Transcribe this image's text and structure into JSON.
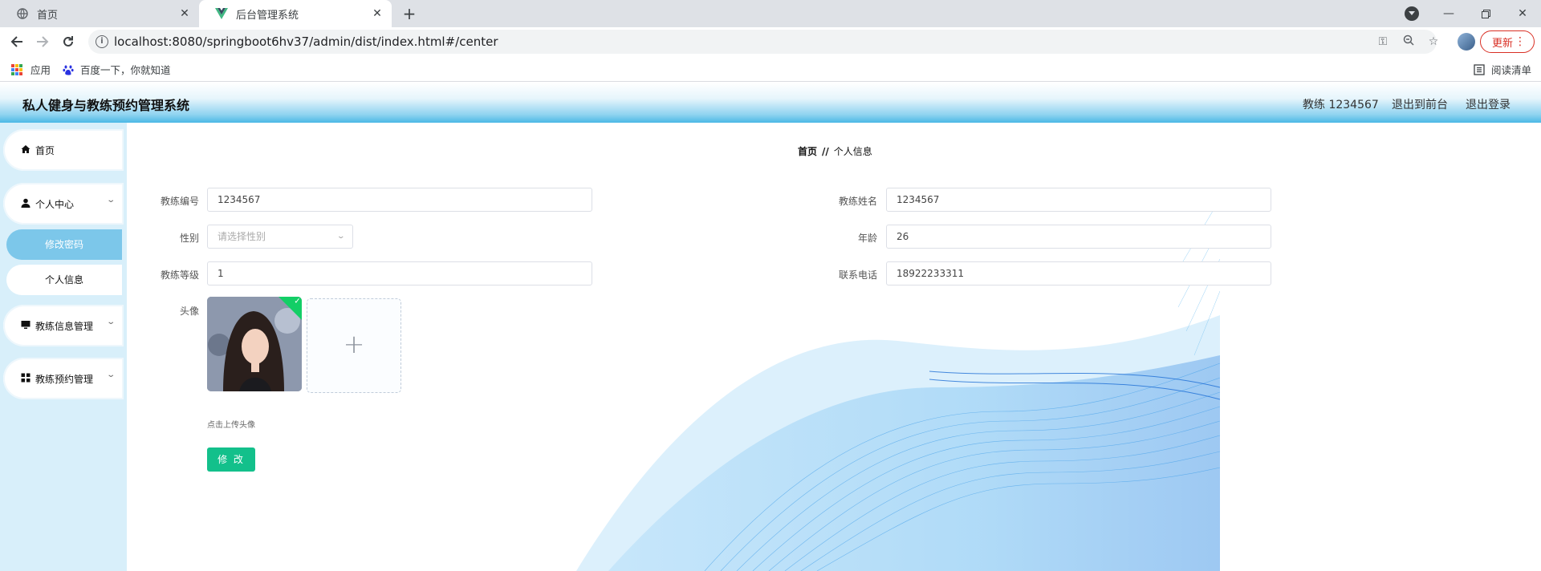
{
  "browser": {
    "tabs": [
      {
        "title": "首页",
        "active": false
      },
      {
        "title": "后台管理系统",
        "active": true
      }
    ],
    "url": "localhost:8080/springboot6hv37/admin/dist/index.html#/center",
    "update_label": "更新",
    "bookmarks": {
      "apps": "应用",
      "baidu": "百度一下，你就知道",
      "reading_list": "阅读清单"
    }
  },
  "app": {
    "title": "私人健身与教练预约管理系统",
    "user": "教练 1234567",
    "to_front": "退出到前台",
    "logout": "退出登录"
  },
  "sidebar": {
    "home": "首页",
    "personal_center": "个人中心",
    "change_password": "修改密码",
    "personal_info": "个人信息",
    "coach_info_mgmt": "教练信息管理",
    "coach_booking_mgmt": "教练预约管理"
  },
  "breadcrumb": {
    "home": "首页",
    "separator": "//",
    "current": "个人信息"
  },
  "form": {
    "coach_no_label": "教练编号",
    "coach_no": "1234567",
    "coach_name_label": "教练姓名",
    "coach_name": "1234567",
    "gender_label": "性别",
    "gender_placeholder": "请选择性别",
    "age_label": "年龄",
    "age": "26",
    "level_label": "教练等级",
    "level": "1",
    "phone_label": "联系电话",
    "phone": "18922233311",
    "avatar_label": "头像",
    "upload_tip": "点击上传头像",
    "submit_label": "修 改"
  },
  "colors": {
    "accent": "#13c08b",
    "header_blue": "#4bb8e6",
    "sidebar_bg": "#d8effa",
    "sidebar_active": "#7cc7ea"
  }
}
